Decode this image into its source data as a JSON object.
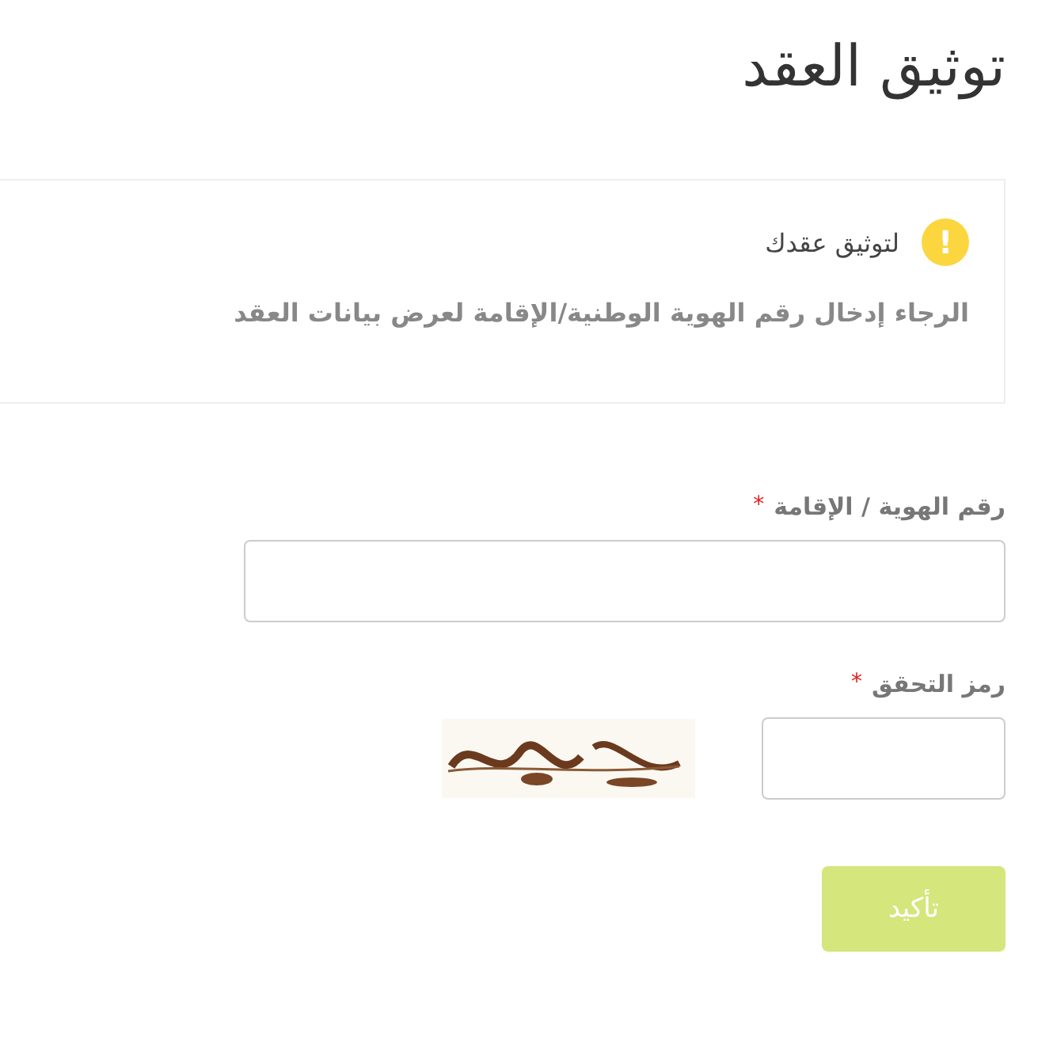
{
  "title": "توثيق العقد",
  "alert": {
    "heading": "لتوثيق عقدك",
    "message": "الرجاء إدخال رقم الهوية الوطنية/الإقامة لعرض بيانات العقد",
    "icon_text": "!"
  },
  "fields": [
    {
      "kind": "text",
      "label": "رقم الهوية / الإقامة",
      "required_mark": "*"
    },
    {
      "kind": "captcha",
      "label": "رمز التحقق",
      "required_mark": "*"
    }
  ],
  "button": {
    "label": "تأكيد",
    "disabled": true
  }
}
